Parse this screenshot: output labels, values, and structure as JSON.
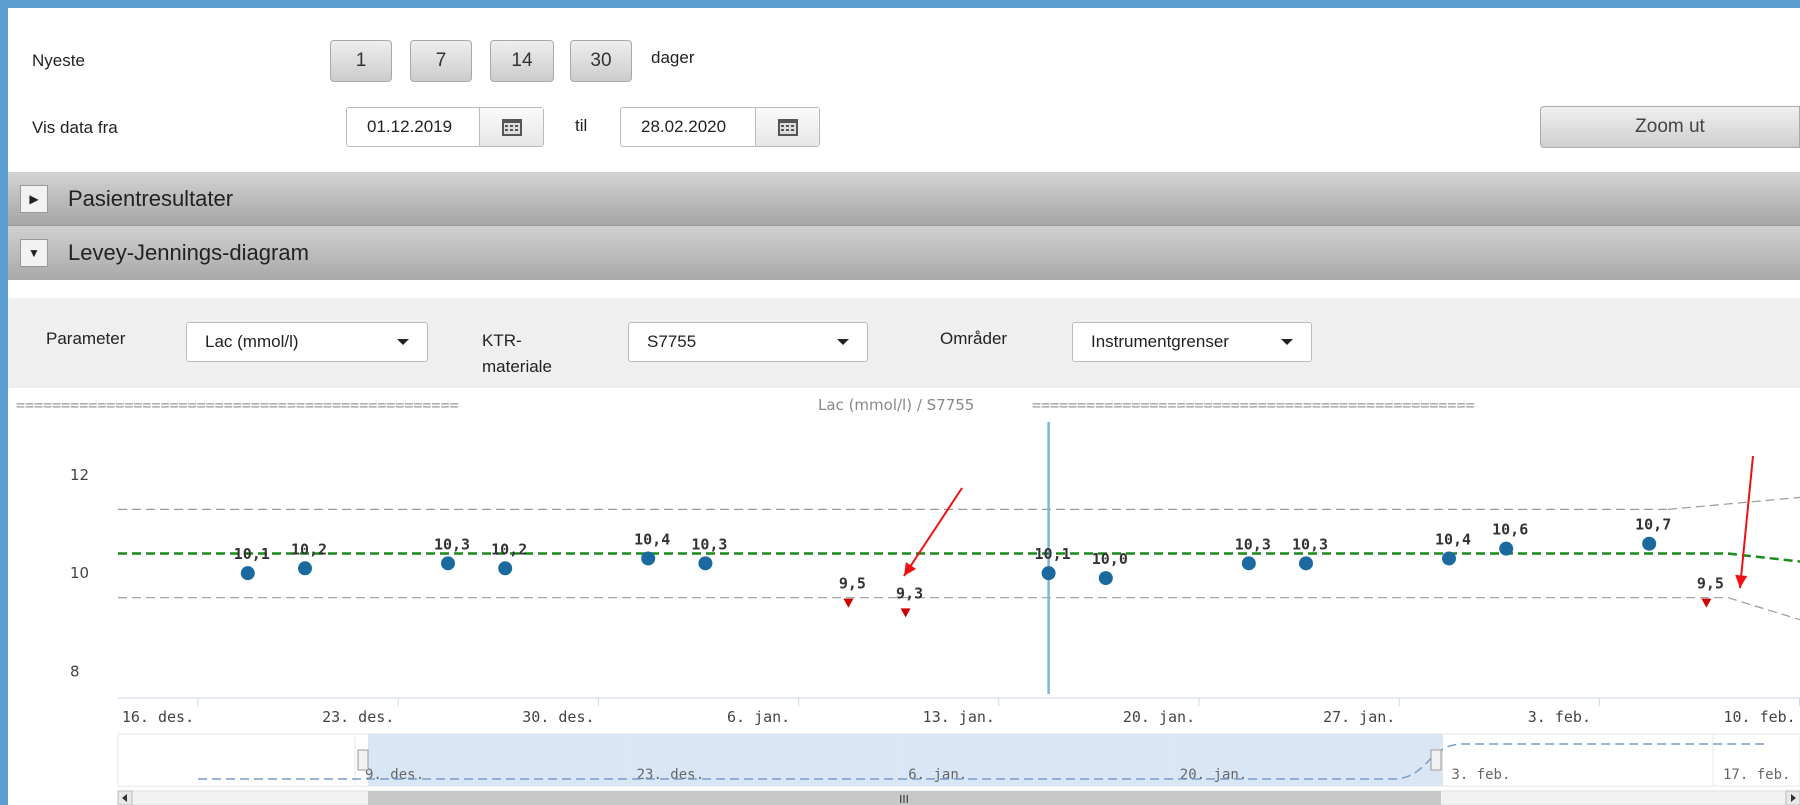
{
  "controls": {
    "newest_label": "Nyeste",
    "day_buttons": [
      "1",
      "7",
      "14",
      "30"
    ],
    "days_unit": "dager",
    "show_from_label": "Vis data fra",
    "date_from": "01.12.2019",
    "til_label": "til",
    "date_to": "28.02.2020",
    "zoom_out_label": "Zoom ut"
  },
  "sections": {
    "patient_results": "Pasientresultater",
    "levey_jennings": "Levey-Jennings-diagram"
  },
  "filters": {
    "parameter_label": "Parameter",
    "parameter_value": "Lac (mmol/l)",
    "ktr_label_line1": "KTR-",
    "ktr_label_line2": "materiale",
    "ktr_value": "S7755",
    "ranges_label": "Områder",
    "ranges_value": "Instrumentgrenser"
  },
  "chart_data": {
    "type": "scatter",
    "title": "Lac (mmol/l) / S7755",
    "title_decor": "=================================================",
    "y_ticks": [
      12,
      10,
      8
    ],
    "ylim": [
      7.7,
      13.0
    ],
    "mean": 10.4,
    "upper_limit": 11.3,
    "lower_limit": 9.5,
    "x_ticks": [
      {
        "label": "16. des.",
        "x": 14
      },
      {
        "label": "23. des.",
        "x": 21
      },
      {
        "label": "30. des.",
        "x": 28
      },
      {
        "label": "6. jan.",
        "x": 35
      },
      {
        "label": "13. jan.",
        "x": 42
      },
      {
        "label": "20. jan.",
        "x": 49
      },
      {
        "label": "27. jan.",
        "x": 56
      },
      {
        "label": "3. feb.",
        "x": 63
      },
      {
        "label": "10. feb.",
        "x": 70
      }
    ],
    "points": [
      {
        "x": 17,
        "y": 10.0,
        "label": "10,1",
        "flag": false
      },
      {
        "x": 19,
        "y": 10.1,
        "label": "10,2",
        "flag": false
      },
      {
        "x": 24,
        "y": 10.2,
        "label": "10,3",
        "flag": false
      },
      {
        "x": 26,
        "y": 10.1,
        "label": "10,2",
        "flag": false
      },
      {
        "x": 31,
        "y": 10.3,
        "label": "10,4",
        "flag": false
      },
      {
        "x": 33,
        "y": 10.2,
        "label": "10,3",
        "flag": false
      },
      {
        "x": 38,
        "y": 9.4,
        "label": "9,5",
        "flag": true
      },
      {
        "x": 40,
        "y": 9.2,
        "label": "9,3",
        "flag": true
      },
      {
        "x": 45,
        "y": 10.0,
        "label": "10,1",
        "flag": false
      },
      {
        "x": 47,
        "y": 9.9,
        "label": "10,0",
        "flag": false
      },
      {
        "x": 52,
        "y": 10.2,
        "label": "10,3",
        "flag": false
      },
      {
        "x": 54,
        "y": 10.2,
        "label": "10,3",
        "flag": false
      },
      {
        "x": 59,
        "y": 10.3,
        "label": "10,4",
        "flag": false
      },
      {
        "x": 61,
        "y": 10.5,
        "label": "10,6",
        "flag": false
      },
      {
        "x": 66,
        "y": 10.6,
        "label": "10,7",
        "flag": false
      },
      {
        "x": 68,
        "y": 9.4,
        "label": "9,5",
        "flag": true
      }
    ],
    "crosshair_x": 45,
    "navigator_ticks": [
      {
        "label": "9. des.",
        "x": 7
      },
      {
        "label": "23. des.",
        "x": 21
      },
      {
        "label": "6. jan.",
        "x": 35
      },
      {
        "label": "20. jan.",
        "x": 49
      },
      {
        "label": "3. feb.",
        "x": 63
      },
      {
        "label": "17. feb.",
        "x": 77
      }
    ],
    "navigator_selection": [
      14,
      70
    ],
    "scrollbar_grip": "III"
  }
}
